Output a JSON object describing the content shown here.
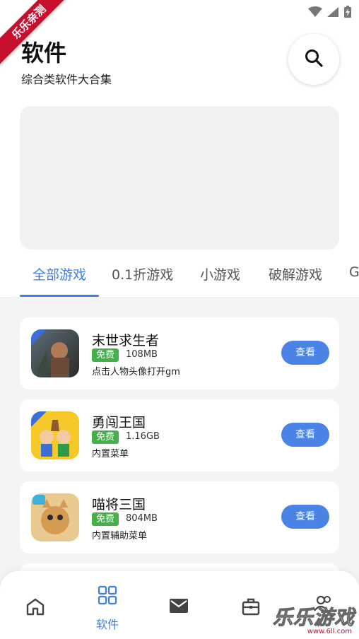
{
  "status_bar": {
    "icons": [
      "wifi-icon",
      "signal-icon",
      "battery-charging-icon"
    ]
  },
  "ribbon": {
    "text": "乐乐亲测"
  },
  "header": {
    "title": "软件",
    "subtitle": "综合类软件大合集",
    "search_icon": "search-icon"
  },
  "tabs": [
    {
      "label": "全部游戏",
      "active": true
    },
    {
      "label": "0.1折游戏",
      "active": false
    },
    {
      "label": "小游戏",
      "active": false
    },
    {
      "label": "破解游戏",
      "active": false
    },
    {
      "label": "G",
      "active": false
    }
  ],
  "apps": [
    {
      "name": "末世求生者",
      "badge": "免费",
      "size": "108MB",
      "desc": "点击人物头像打开gm",
      "button": "查看"
    },
    {
      "name": "勇闯王国",
      "badge": "免费",
      "size": "1.16GB",
      "desc": "内置菜单",
      "button": "查看"
    },
    {
      "name": "喵将三国",
      "badge": "免费",
      "size": "804MB",
      "desc": "内置辅助菜单",
      "button": "查看"
    }
  ],
  "bottom_nav": [
    {
      "icon": "home-icon",
      "label": ""
    },
    {
      "icon": "apps-grid-icon",
      "label": "软件"
    },
    {
      "icon": "mail-icon",
      "label": ""
    },
    {
      "icon": "toolbox-icon",
      "label": ""
    },
    {
      "icon": "users-icon",
      "label": ""
    }
  ],
  "watermark": {
    "text": "乐乐游戏",
    "url": "www.6ll.com"
  },
  "colors": {
    "accent": "#3f7be8",
    "free_badge": "#43b04a",
    "button": "#4a82e6",
    "ribbon": "#c8102e"
  }
}
